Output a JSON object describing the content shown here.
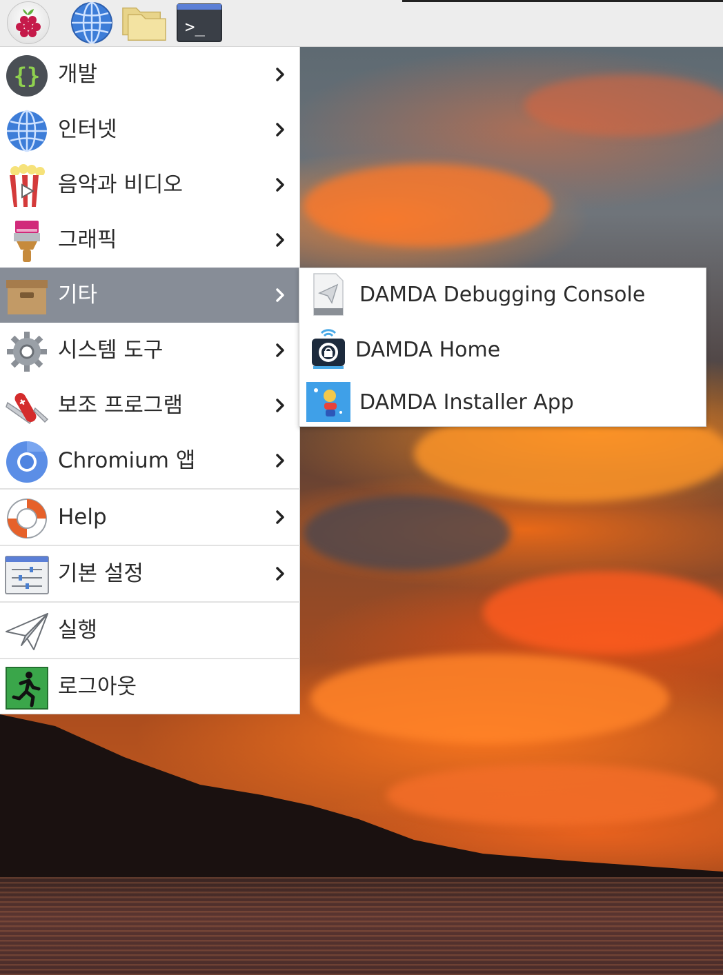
{
  "taskbar": {
    "launchers": [
      {
        "name": "raspberry-menu",
        "icon": "raspberry-pi-icon"
      },
      {
        "name": "web-browser",
        "icon": "globe-icon"
      },
      {
        "name": "file-manager",
        "icon": "folder-icon"
      },
      {
        "name": "terminal",
        "icon": "terminal-icon",
        "glyph": ">_"
      }
    ]
  },
  "main_menu": {
    "items": [
      {
        "label": "개발",
        "icon": "braces-icon",
        "has_submenu": true,
        "active": false
      },
      {
        "label": "인터넷",
        "icon": "globe-icon",
        "has_submenu": true,
        "active": false
      },
      {
        "label": "음악과 비디오",
        "icon": "popcorn-play-icon",
        "has_submenu": true,
        "active": false
      },
      {
        "label": "그래픽",
        "icon": "paintbrush-icon",
        "has_submenu": true,
        "active": false
      },
      {
        "label": "기타",
        "icon": "box-icon",
        "has_submenu": true,
        "active": true
      },
      {
        "label": "시스템 도구",
        "icon": "gear-icon",
        "has_submenu": true,
        "active": false
      },
      {
        "label": "보조 프로그램",
        "icon": "pocket-knife-icon",
        "has_submenu": true,
        "active": false
      },
      {
        "label": "Chromium 앱",
        "icon": "chromium-icon",
        "has_submenu": true,
        "active": false
      },
      {
        "label": "Help",
        "icon": "lifebuoy-icon",
        "has_submenu": true,
        "active": false
      },
      {
        "label": "기본 설정",
        "icon": "settings-sliders-icon",
        "has_submenu": true,
        "active": false
      },
      {
        "label": "실행",
        "icon": "paper-plane-icon",
        "has_submenu": false,
        "active": false
      },
      {
        "label": "로그아웃",
        "icon": "exit-icon",
        "has_submenu": false,
        "active": false
      }
    ]
  },
  "submenu": {
    "parent": "기타",
    "items": [
      {
        "label": "DAMDA Debugging Console",
        "icon": "paper-plane-file-icon"
      },
      {
        "label": "DAMDA Home",
        "icon": "damda-home-icon"
      },
      {
        "label": "DAMDA Installer App",
        "icon": "damda-installer-icon"
      }
    ]
  },
  "colors": {
    "panel_bg": "#ededed",
    "menu_bg": "#ffffff",
    "active_item_bg": "#878d97",
    "text": "#2b2b2b"
  }
}
